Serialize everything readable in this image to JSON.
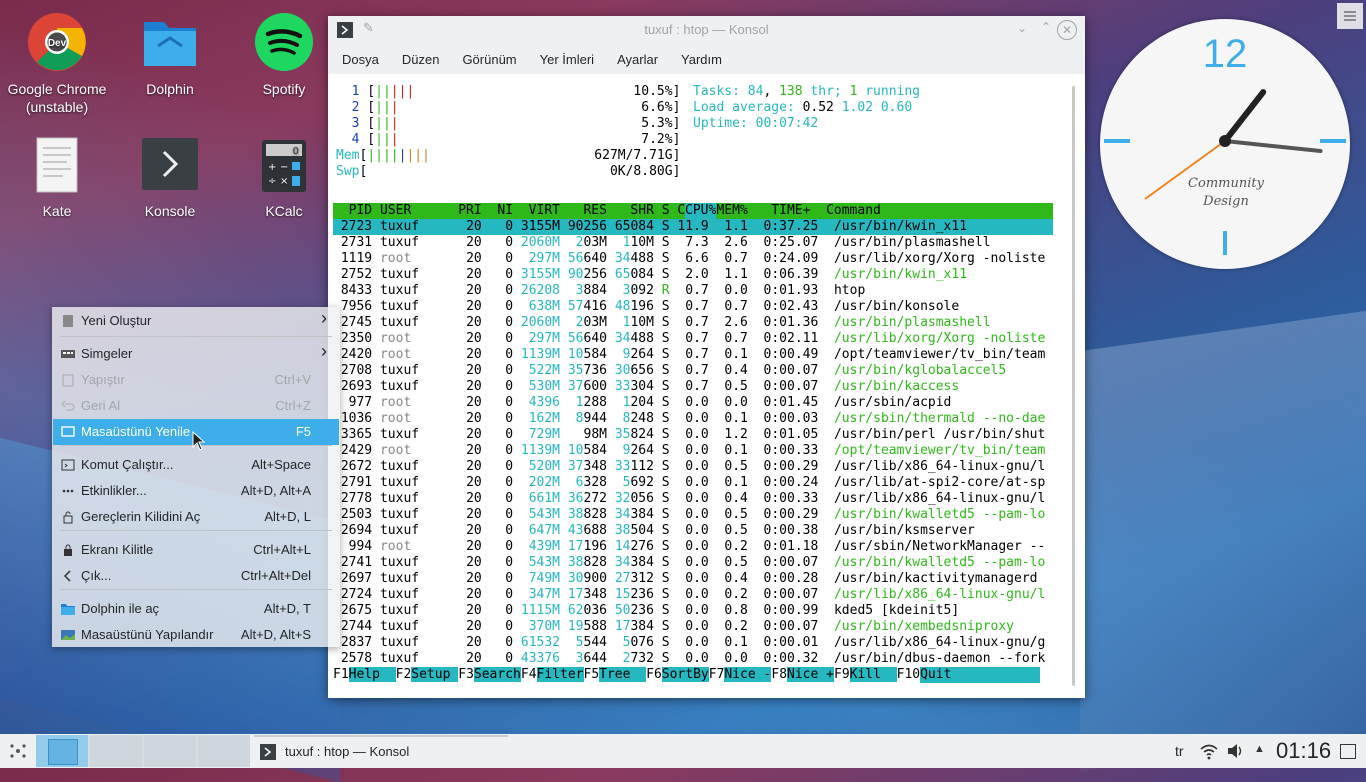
{
  "desktop_icons": [
    {
      "label": "Google Chrome (unstable)"
    },
    {
      "label": "Dolphin"
    },
    {
      "label": "Spotify"
    },
    {
      "label": "Kate"
    },
    {
      "label": "Konsole"
    },
    {
      "label": "KCalc"
    }
  ],
  "window": {
    "title": "tuxuf : htop — Konsol",
    "menu": [
      "Dosya",
      "Düzen",
      "Görünüm",
      "Yer İmleri",
      "Ayarlar",
      "Yardım"
    ]
  },
  "htop": {
    "cpus": [
      {
        "id": "1",
        "bar": "|||||",
        "pct": "10.5%"
      },
      {
        "id": "2",
        "bar": "|||",
        "pct": "6.6%"
      },
      {
        "id": "3",
        "bar": "|||",
        "pct": "5.3%"
      },
      {
        "id": "4",
        "bar": "|||",
        "pct": "7.2%"
      }
    ],
    "mem": {
      "label": "Mem",
      "bar": "||||||||",
      "val": "627M/7.71G"
    },
    "swp": {
      "label": "Swp",
      "val": "0K/8.80G"
    },
    "tasks_label": "Tasks: ",
    "tasks": "84",
    "thr": "138",
    "thr_label": " thr; ",
    "running": "1",
    "running_label": " running",
    "load_label": "Load average: ",
    "load1": "0.52",
    "load5": "1.02",
    "load15": "0.60",
    "uptime_label": "Uptime: ",
    "uptime": "00:07:42",
    "header": "  PID USER      PRI  NI  VIRT   RES   SHR S CPU% MEM%   TIME+  Command",
    "rows": [
      [
        " 2723",
        "tuxuf",
        "20",
        "0",
        "3155M",
        "90256",
        "65084",
        "S",
        "11.9",
        "1.1",
        "0:37.25",
        "/usr/bin/kwin_x11"
      ],
      [
        " 2731",
        "tuxuf",
        "20",
        "0",
        "2060M",
        " 203M",
        " 110M",
        "S",
        " 7.3",
        "2.6",
        "0:25.07",
        "/usr/bin/plasmashell"
      ],
      [
        " 1119",
        "root",
        "20",
        "0",
        " 297M",
        "56640",
        "34488",
        "S",
        " 6.6",
        "0.7",
        "0:24.09",
        "/usr/lib/xorg/Xorg -noliste"
      ],
      [
        " 2752",
        "tuxuf",
        "20",
        "0",
        "3155M",
        "90256",
        "65084",
        "S",
        " 2.0",
        "1.1",
        "0:06.39",
        "/usr/bin/kwin_x11"
      ],
      [
        " 8433",
        "tuxuf",
        "20",
        "0",
        "26208",
        " 3884",
        " 3092",
        "R",
        " 0.7",
        "0.0",
        "0:01.93",
        "htop"
      ],
      [
        " 7956",
        "tuxuf",
        "20",
        "0",
        " 638M",
        "57416",
        "48196",
        "S",
        " 0.7",
        "0.7",
        "0:02.43",
        "/usr/bin/konsole"
      ],
      [
        " 2745",
        "tuxuf",
        "20",
        "0",
        "2060M",
        " 203M",
        " 110M",
        "S",
        " 0.7",
        "2.6",
        "0:01.36",
        "/usr/bin/plasmashell"
      ],
      [
        " 2350",
        "root",
        "20",
        "0",
        " 297M",
        "56640",
        "34488",
        "S",
        " 0.7",
        "0.7",
        "0:02.11",
        "/usr/lib/xorg/Xorg -noliste"
      ],
      [
        " 2420",
        "root",
        "20",
        "0",
        "1139M",
        "10584",
        " 9264",
        "S",
        " 0.7",
        "0.1",
        "0:00.49",
        "/opt/teamviewer/tv_bin/team"
      ],
      [
        " 2708",
        "tuxuf",
        "20",
        "0",
        " 522M",
        "35736",
        "30656",
        "S",
        " 0.7",
        "0.4",
        "0:00.07",
        "/usr/bin/kglobalaccel5"
      ],
      [
        " 2693",
        "tuxuf",
        "20",
        "0",
        " 530M",
        "37600",
        "33304",
        "S",
        " 0.7",
        "0.5",
        "0:00.07",
        "/usr/bin/kaccess"
      ],
      [
        "  977",
        "root",
        "20",
        "0",
        " 4396",
        " 1288",
        " 1204",
        "S",
        " 0.0",
        "0.0",
        "0:01.45",
        "/usr/sbin/acpid"
      ],
      [
        " 1036",
        "root",
        "20",
        "0",
        " 162M",
        " 8944",
        " 8248",
        "S",
        " 0.0",
        "0.1",
        "0:00.03",
        "/usr/sbin/thermald --no-dae"
      ],
      [
        " 3365",
        "tuxuf",
        "20",
        "0",
        " 729M",
        "  98M",
        "35824",
        "S",
        " 0.0",
        "1.2",
        "0:01.05",
        "/usr/bin/perl /usr/bin/shut"
      ],
      [
        " 2429",
        "root",
        "20",
        "0",
        "1139M",
        "10584",
        " 9264",
        "S",
        " 0.0",
        "0.1",
        "0:00.33",
        "/opt/teamviewer/tv_bin/team"
      ],
      [
        " 2672",
        "tuxuf",
        "20",
        "0",
        " 520M",
        "37348",
        "33112",
        "S",
        " 0.0",
        "0.5",
        "0:00.29",
        "/usr/lib/x86_64-linux-gnu/l"
      ],
      [
        " 2791",
        "tuxuf",
        "20",
        "0",
        " 202M",
        " 6328",
        " 5692",
        "S",
        " 0.0",
        "0.1",
        "0:00.24",
        "/usr/lib/at-spi2-core/at-sp"
      ],
      [
        " 2778",
        "tuxuf",
        "20",
        "0",
        " 661M",
        "36272",
        "32056",
        "S",
        " 0.0",
        "0.4",
        "0:00.33",
        "/usr/lib/x86_64-linux-gnu/l"
      ],
      [
        " 2503",
        "tuxuf",
        "20",
        "0",
        " 543M",
        "38828",
        "34384",
        "S",
        " 0.0",
        "0.5",
        "0:00.29",
        "/usr/bin/kwalletd5 --pam-lo"
      ],
      [
        " 2694",
        "tuxuf",
        "20",
        "0",
        " 647M",
        "43688",
        "38504",
        "S",
        " 0.0",
        "0.5",
        "0:00.38",
        "/usr/bin/ksmserver"
      ],
      [
        "  994",
        "root",
        "20",
        "0",
        " 439M",
        "17196",
        "14276",
        "S",
        " 0.0",
        "0.2",
        "0:01.18",
        "/usr/sbin/NetworkManager --"
      ],
      [
        " 2741",
        "tuxuf",
        "20",
        "0",
        " 543M",
        "38828",
        "34384",
        "S",
        " 0.0",
        "0.5",
        "0:00.07",
        "/usr/bin/kwalletd5 --pam-lo"
      ],
      [
        " 2697",
        "tuxuf",
        "20",
        "0",
        " 749M",
        "30900",
        "27312",
        "S",
        " 0.0",
        "0.4",
        "0:00.28",
        "/usr/bin/kactivitymanagerd"
      ],
      [
        " 2724",
        "tuxuf",
        "20",
        "0",
        " 347M",
        "17348",
        "15236",
        "S",
        " 0.0",
        "0.2",
        "0:00.07",
        "/usr/lib/x86_64-linux-gnu/l"
      ],
      [
        " 2675",
        "tuxuf",
        "20",
        "0",
        "1115M",
        "62036",
        "50236",
        "S",
        " 0.0",
        "0.8",
        "0:00.99",
        "kded5 [kdeinit5]"
      ],
      [
        " 2744",
        "tuxuf",
        "20",
        "0",
        " 370M",
        "19588",
        "17384",
        "S",
        " 0.0",
        "0.2",
        "0:00.07",
        "/usr/bin/xembedsniproxy"
      ],
      [
        " 2837",
        "tuxuf",
        "20",
        "0",
        "61532",
        " 5544",
        " 5076",
        "S",
        " 0.0",
        "0.1",
        "0:00.01",
        "/usr/lib/x86_64-linux-gnu/g"
      ],
      [
        " 2578",
        "tuxuf",
        "20",
        "0",
        "43376",
        " 3644",
        " 2732",
        "S",
        " 0.0",
        "0.0",
        "0:00.32",
        "/usr/bin/dbus-daemon --fork"
      ]
    ],
    "green_cmd_rows": [
      3,
      6,
      7,
      9,
      10,
      12,
      14,
      18,
      21,
      23,
      25
    ],
    "fkeys": [
      [
        "F1",
        "Help  "
      ],
      [
        "F2",
        "Setup "
      ],
      [
        "F3",
        "Search"
      ],
      [
        "F4",
        "Filter"
      ],
      [
        "F5",
        "Tree  "
      ],
      [
        "F6",
        "SortBy"
      ],
      [
        "F7",
        "Nice -"
      ],
      [
        "F8",
        "Nice +"
      ],
      [
        "F9",
        "Kill  "
      ],
      [
        "F10",
        "Quit"
      ]
    ]
  },
  "context_menu": {
    "items": [
      {
        "label": "Yeni Oluştur",
        "shortcut": "",
        "submenu": true,
        "disabled": false,
        "icon": "new-document-icon"
      },
      {
        "label": "Simgeler",
        "shortcut": "",
        "submenu": true,
        "disabled": false,
        "icon": "icons-grid-icon"
      },
      {
        "label": "Yapıştır",
        "shortcut": "Ctrl+V",
        "submenu": false,
        "disabled": true,
        "icon": "paste-icon"
      },
      {
        "label": "Geri Al",
        "shortcut": "Ctrl+Z",
        "submenu": false,
        "disabled": true,
        "icon": "undo-icon"
      },
      {
        "label": "Masaüstünü Yenile",
        "shortcut": "F5",
        "submenu": false,
        "disabled": false,
        "icon": "refresh-desktop-icon",
        "highlighted": true
      },
      {
        "label": "Komut Çalıştır...",
        "shortcut": "Alt+Space",
        "submenu": false,
        "disabled": false,
        "icon": "run-command-icon"
      },
      {
        "label": "Etkinlikler...",
        "shortcut": "Alt+D, Alt+A",
        "submenu": false,
        "disabled": false,
        "icon": "activities-icon"
      },
      {
        "label": "Gereçlerin Kilidini Aç",
        "shortcut": "Alt+D, L",
        "submenu": false,
        "disabled": false,
        "icon": "unlock-icon"
      },
      {
        "label": "Ekranı Kilitle",
        "shortcut": "Ctrl+Alt+L",
        "submenu": false,
        "disabled": false,
        "icon": "lock-icon"
      },
      {
        "label": "Çık...",
        "shortcut": "Ctrl+Alt+Del",
        "submenu": false,
        "disabled": false,
        "icon": "logout-icon"
      },
      {
        "label": "Dolphin ile aç",
        "shortcut": "Alt+D, T",
        "submenu": false,
        "disabled": false,
        "icon": "folder-icon"
      },
      {
        "label": "Masaüstünü Yapılandır",
        "shortcut": "Alt+D, Alt+S",
        "submenu": false,
        "disabled": false,
        "icon": "wallpaper-icon"
      }
    ]
  },
  "clock": {
    "twelve": "12",
    "brand": "Community Design",
    "hour": 1,
    "minute": 16
  },
  "taskbar": {
    "task_label": "tuxuf : htop — Konsol",
    "lang": "tr",
    "time": "01:16"
  },
  "colors": {
    "accent": "#3daee9",
    "htop_header": "#2fb81a",
    "htop_select": "#26b8c0"
  }
}
